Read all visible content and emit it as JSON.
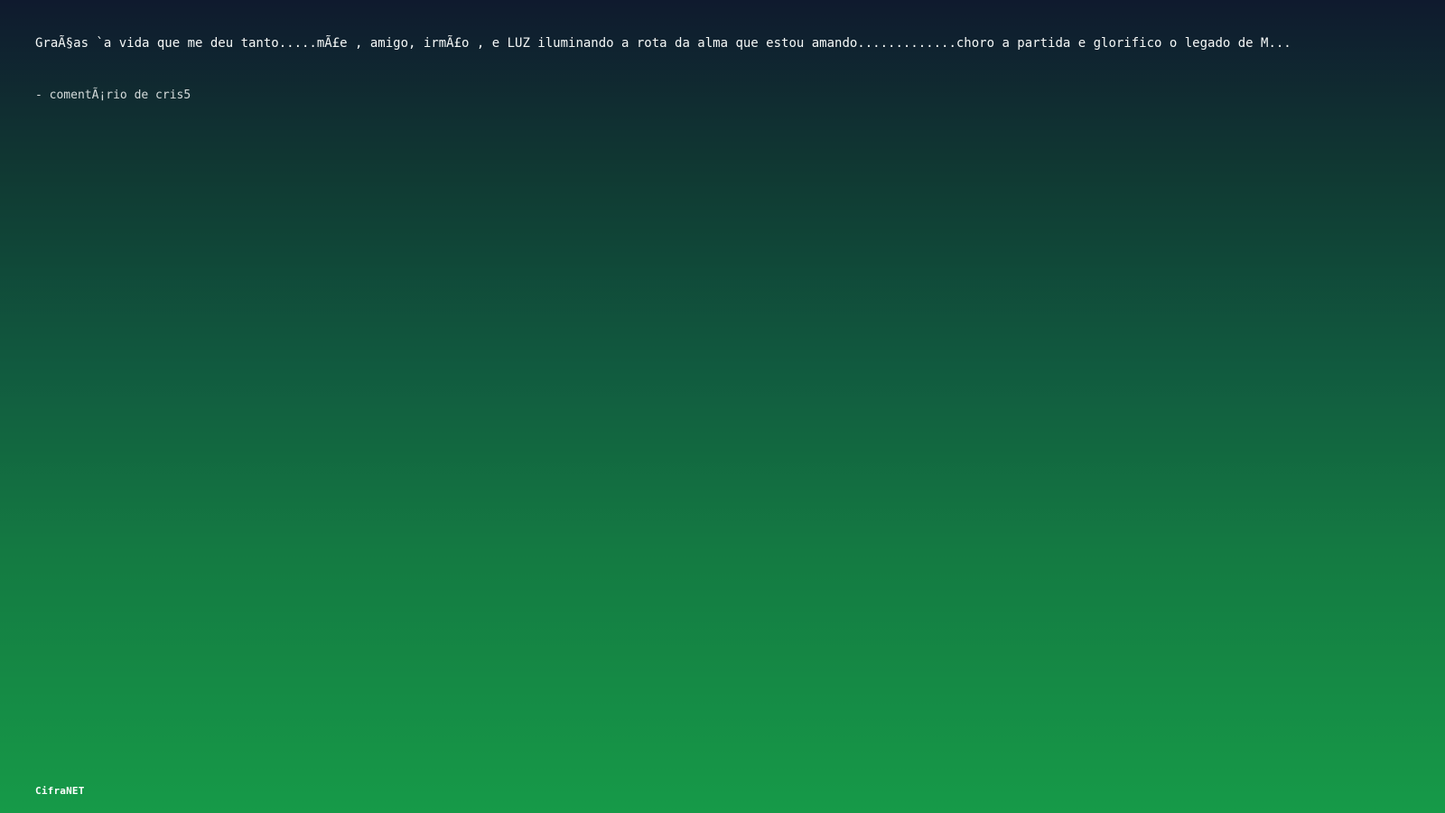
{
  "comment": {
    "text": "GraÃ§as `a vida que me deu tanto.....mÃ£e , amigo, irmÃ£o , e LUZ iluminando a rota da alma que estou amando.............choro a partida e glorifico o legado de M...",
    "author_line": "- comentÃ¡rio de cris5"
  },
  "footer": {
    "brand": "CifraNET"
  },
  "colors": {
    "background_top": "#0f1a2e",
    "background_bottom": "#169a48",
    "text": "#f4f7f6"
  }
}
